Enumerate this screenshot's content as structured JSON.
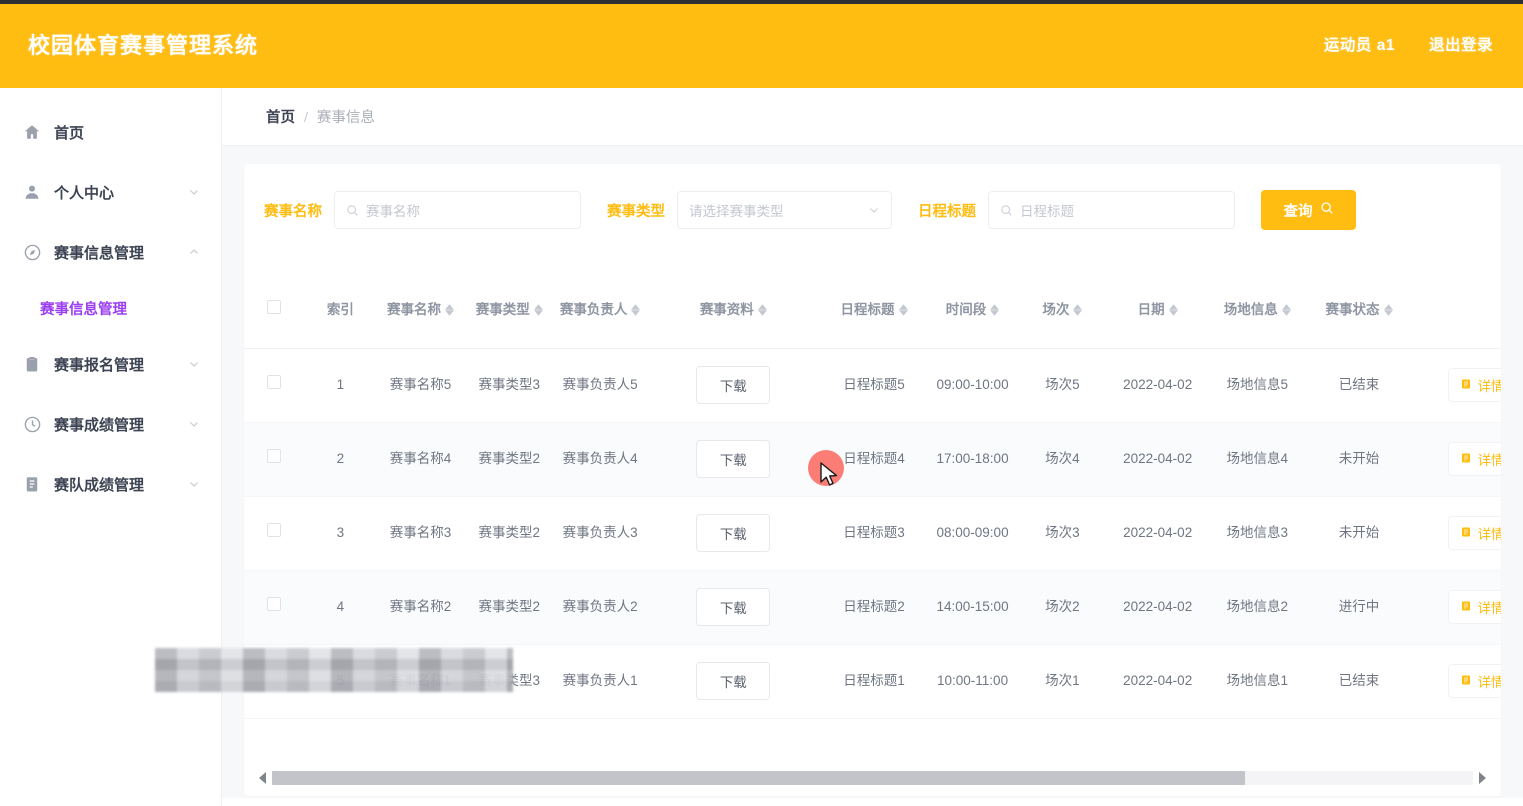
{
  "header": {
    "brand": "校园体育赛事管理系统",
    "user": "运动员 a1",
    "logout": "退出登录"
  },
  "sidebar": {
    "items": [
      {
        "label": "首页",
        "icon": "home-icon",
        "arrow": "none"
      },
      {
        "label": "个人中心",
        "icon": "user-icon",
        "arrow": "down"
      },
      {
        "label": "赛事信息管理",
        "icon": "compass-icon",
        "arrow": "up"
      },
      {
        "label": "赛事报名管理",
        "icon": "clipboard-icon",
        "arrow": "down"
      },
      {
        "label": "赛事成绩管理",
        "icon": "clock-icon",
        "arrow": "down"
      },
      {
        "label": "赛队成绩管理",
        "icon": "document-icon",
        "arrow": "down"
      }
    ],
    "active_submenu": "赛事信息管理"
  },
  "breadcrumb": {
    "home": "首页",
    "separator": "/",
    "current": "赛事信息"
  },
  "search": {
    "name_label": "赛事名称",
    "name_placeholder": "赛事名称",
    "name_value": "",
    "type_label": "赛事类型",
    "type_placeholder": "请选择赛事类型",
    "type_value": "",
    "schedule_label": "日程标题",
    "schedule_placeholder": "日程标题",
    "schedule_value": "",
    "query_button": "查询"
  },
  "table": {
    "columns": [
      {
        "key": "checkbox",
        "label": "",
        "sortable": false
      },
      {
        "key": "index",
        "label": "索引",
        "sortable": false
      },
      {
        "key": "name",
        "label": "赛事名称",
        "sortable": true
      },
      {
        "key": "type",
        "label": "赛事类型",
        "sortable": true
      },
      {
        "key": "owner",
        "label": "赛事负责人",
        "sortable": true
      },
      {
        "key": "file",
        "label": "赛事资料",
        "sortable": true
      },
      {
        "key": "schedule",
        "label": "日程标题",
        "sortable": true
      },
      {
        "key": "timeslot",
        "label": "时间段",
        "sortable": true
      },
      {
        "key": "session",
        "label": "场次",
        "sortable": true
      },
      {
        "key": "date",
        "label": "日期",
        "sortable": true
      },
      {
        "key": "venue",
        "label": "场地信息",
        "sortable": true
      },
      {
        "key": "status",
        "label": "赛事状态",
        "sortable": true
      },
      {
        "key": "action",
        "label": "",
        "sortable": false
      }
    ],
    "download_label": "下载",
    "detail_label": "详情",
    "rows": [
      {
        "index": "1",
        "name": "赛事名称5",
        "type": "赛事类型3",
        "owner": "赛事负责人5",
        "file": "下载",
        "schedule": "日程标题5",
        "timeslot": "09:00-10:00",
        "session": "场次5",
        "date": "2022-04-02",
        "venue": "场地信息5",
        "status": "已结束",
        "action": "详情"
      },
      {
        "index": "2",
        "name": "赛事名称4",
        "type": "赛事类型2",
        "owner": "赛事负责人4",
        "file": "下载",
        "schedule": "日程标题4",
        "timeslot": "17:00-18:00",
        "session": "场次4",
        "date": "2022-04-02",
        "venue": "场地信息4",
        "status": "未开始",
        "action": "详情"
      },
      {
        "index": "3",
        "name": "赛事名称3",
        "type": "赛事类型2",
        "owner": "赛事负责人3",
        "file": "下载",
        "schedule": "日程标题3",
        "timeslot": "08:00-09:00",
        "session": "场次3",
        "date": "2022-04-02",
        "venue": "场地信息3",
        "status": "未开始",
        "action": "详情"
      },
      {
        "index": "4",
        "name": "赛事名称2",
        "type": "赛事类型2",
        "owner": "赛事负责人2",
        "file": "下载",
        "schedule": "日程标题2",
        "timeslot": "14:00-15:00",
        "session": "场次2",
        "date": "2022-04-02",
        "venue": "场地信息2",
        "status": "进行中",
        "action": "详情"
      },
      {
        "index": "5",
        "name": "赛事名称1",
        "type": "赛事类型3",
        "owner": "赛事负责人1",
        "file": "下载",
        "schedule": "日程标题1",
        "timeslot": "10:00-11:00",
        "session": "场次1",
        "date": "2022-04-02",
        "venue": "场地信息1",
        "status": "已结束",
        "action": "详情"
      }
    ]
  },
  "colors": {
    "brand_amber": "#FFBC11",
    "active_purple": "#9b3df0",
    "cursor_highlight": "#fa6b63",
    "page_bg": "#f7f8fa",
    "text_muted": "#8f96a3"
  }
}
